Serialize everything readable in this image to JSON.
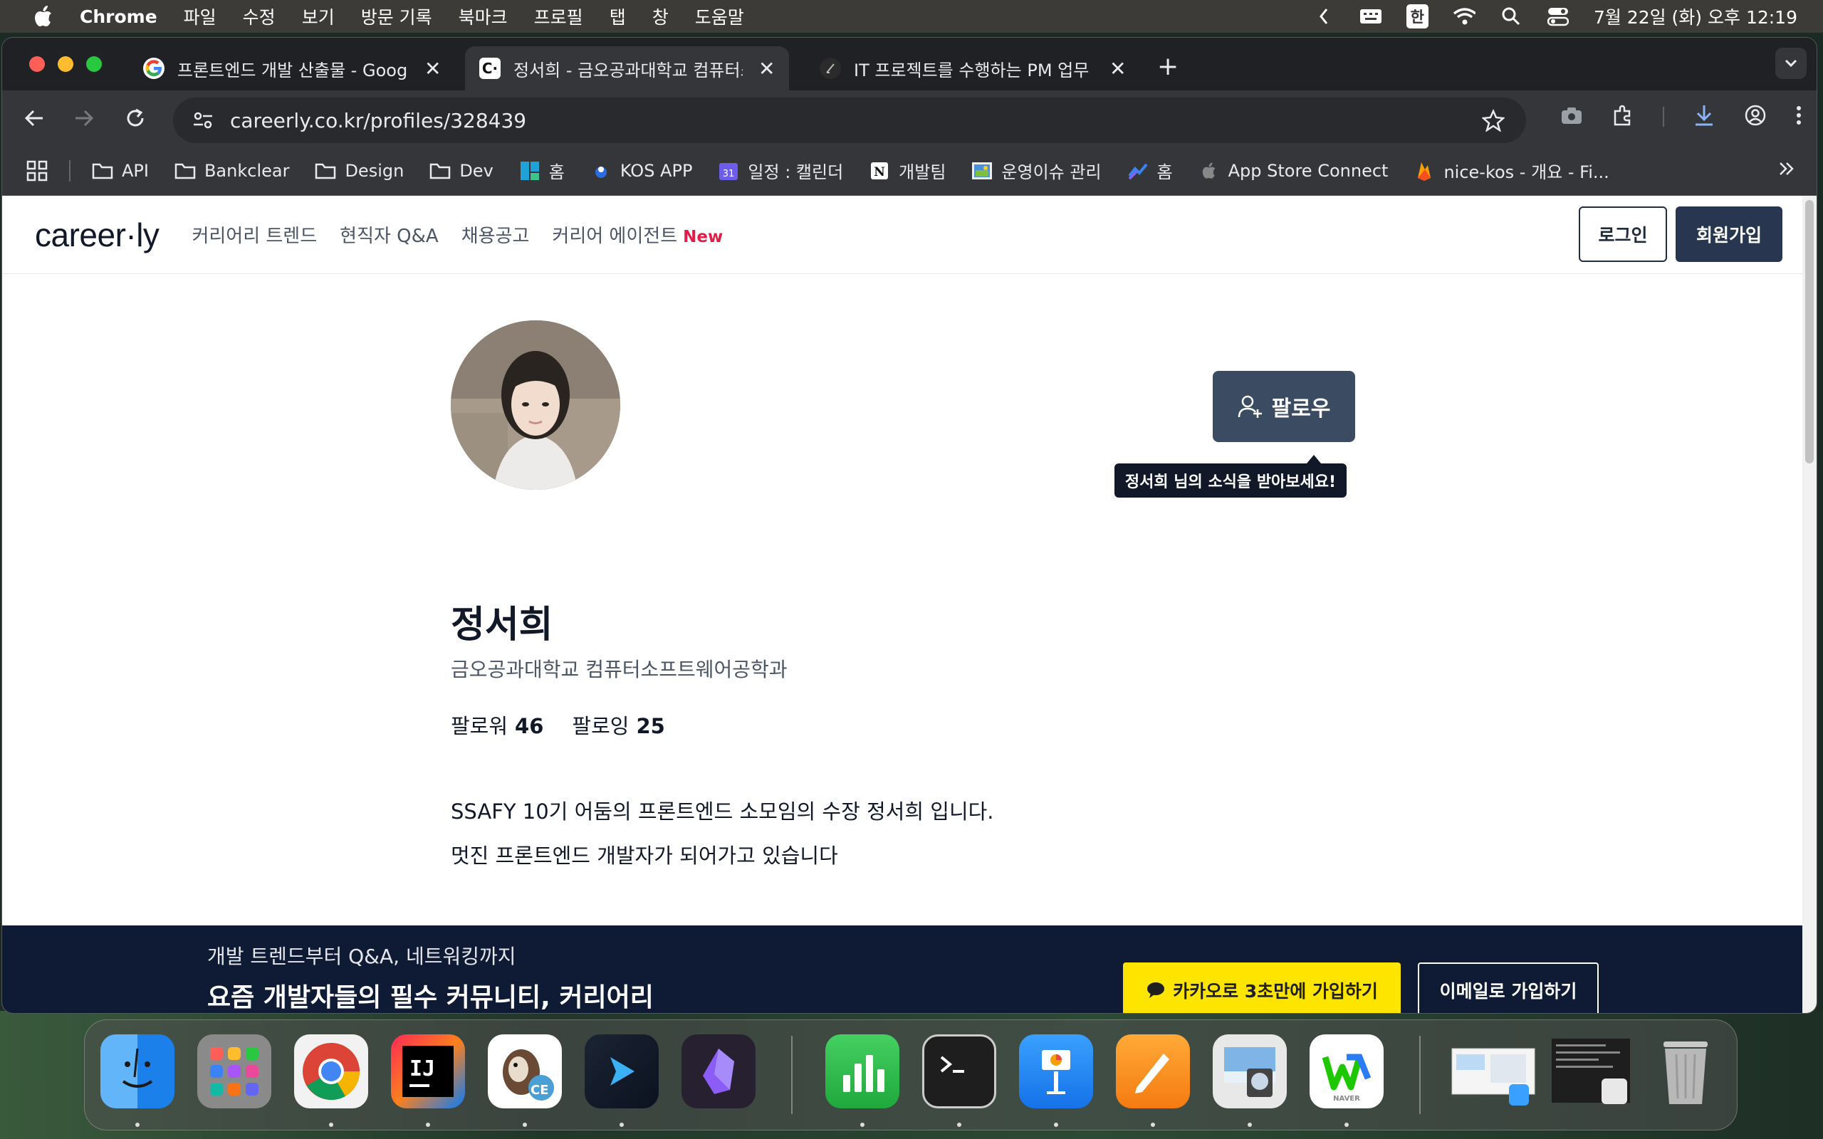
{
  "menubar": {
    "app": "Chrome",
    "items": [
      "파일",
      "수정",
      "보기",
      "방문 기록",
      "북마크",
      "프로필",
      "탭",
      "창",
      "도움말"
    ],
    "input_badge": "한",
    "clock": "7월 22일 (화) 오후 12:19"
  },
  "tabs": [
    {
      "title": "프론트엔드 개발 산출물 - Google",
      "icon": "google-icon"
    },
    {
      "title": "정서희 - 금오공과대학교 컴퓨터소프",
      "icon": "careerly-icon"
    },
    {
      "title": "IT 프로젝트를 수행하는 PM 업무 &",
      "icon": "notion-icon"
    }
  ],
  "toolbar": {
    "url": "careerly.co.kr/profiles/328439"
  },
  "bookmarks": [
    "API",
    "Bankclear",
    "Design",
    "Dev",
    "홈",
    "KOS APP",
    "일정 : 캘린더",
    "개발팀",
    "운영이슈 관리",
    "홈",
    "App Store Connect",
    "nice-kos - 개요 - Fi..."
  ],
  "site": {
    "logo": "career·ly",
    "nav": [
      "커리어리 트렌드",
      "현직자 Q&A",
      "채용공고",
      "커리어 에이전트"
    ],
    "nav_new_badge": "New",
    "login": "로그인",
    "signup": "회원가입"
  },
  "profile": {
    "follow_label": "팔로우",
    "tooltip": "정서희 님의 소식을 받아보세요!",
    "name": "정서희",
    "school": "금오공과대학교 컴퓨터소프트웨어공학과",
    "followers_label": "팔로워",
    "followers_count": "46",
    "following_label": "팔로잉",
    "following_count": "25",
    "bio_line1": "SSAFY 10기 어둠의 프론트엔드 소모임의 수장 정서희 입니다.",
    "bio_line2": "멋진 프론트엔드 개발자가 되어가고 있습니다"
  },
  "banner": {
    "sub": "개발 트렌드부터 Q&A, 네트워킹까지",
    "main": "요즘 개발자들의 필수 커뮤니티, 커리어리",
    "kakao": "카카오로 3초만에 가입하기",
    "email": "이메일로 가입하기"
  },
  "dock": {
    "apps": [
      "finder-icon",
      "launchpad-icon",
      "chrome-icon",
      "intellij-icon",
      "dbeaver-icon",
      "terminal-app-icon",
      "obsidian-icon",
      "numbers-icon",
      "terminal-icon",
      "keynote-icon",
      "pages-icon",
      "preview-icon",
      "naver-whale-icon"
    ],
    "ij_text": "IJ",
    "ce_badge": "CE",
    "naver_text": "NAVER"
  },
  "colors": {
    "brand_navy": "#28374f",
    "banner_bg": "#0f1b35",
    "kakao_yellow": "#fee500",
    "new_red": "#e11d48"
  }
}
